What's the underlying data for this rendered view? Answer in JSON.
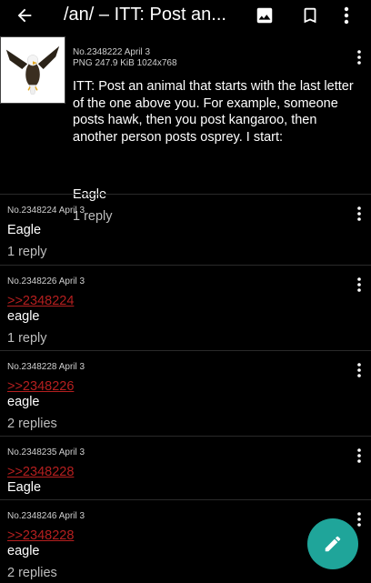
{
  "header": {
    "title": "/an/ – ITT: Post an...",
    "icons": [
      "back-arrow-icon",
      "image-gallery-icon",
      "bookmark-icon",
      "more-vertical-icon"
    ]
  },
  "op": {
    "post_no": "No.2348222 April 3",
    "file_info": "PNG 247.9 KiB 1024x768",
    "thumbnail": "eagle-thumbnail",
    "comment": "ITT: Post an animal that starts with the last letter of the one above you. For example, someone posts hawk, then you post kangaroo, then another person posts osprey. I start:",
    "comment_tail": "Eagle",
    "replies": "1 reply"
  },
  "posts": [
    {
      "meta": "No.2348224 April 3",
      "quote": "",
      "text": "Eagle",
      "replies": "1 reply"
    },
    {
      "meta": "No.2348226 April 3",
      "quote": ">>2348224",
      "text": "eagle",
      "replies": "1 reply"
    },
    {
      "meta": "No.2348228 April 3",
      "quote": ">>2348226",
      "text": "eagle",
      "replies": "2 replies"
    },
    {
      "meta": "No.2348235 April 3",
      "quote": ">>2348228",
      "text": "Eagle",
      "replies": ""
    },
    {
      "meta": "No.2348246 April 3",
      "quote": ">>2348228",
      "text": "eagle",
      "replies": "2 replies"
    }
  ],
  "fab": {
    "icon": "pencil-icon"
  },
  "colors": {
    "background": "#000000",
    "quote_link": "#b51f1f",
    "fab": "#1fa59a"
  }
}
